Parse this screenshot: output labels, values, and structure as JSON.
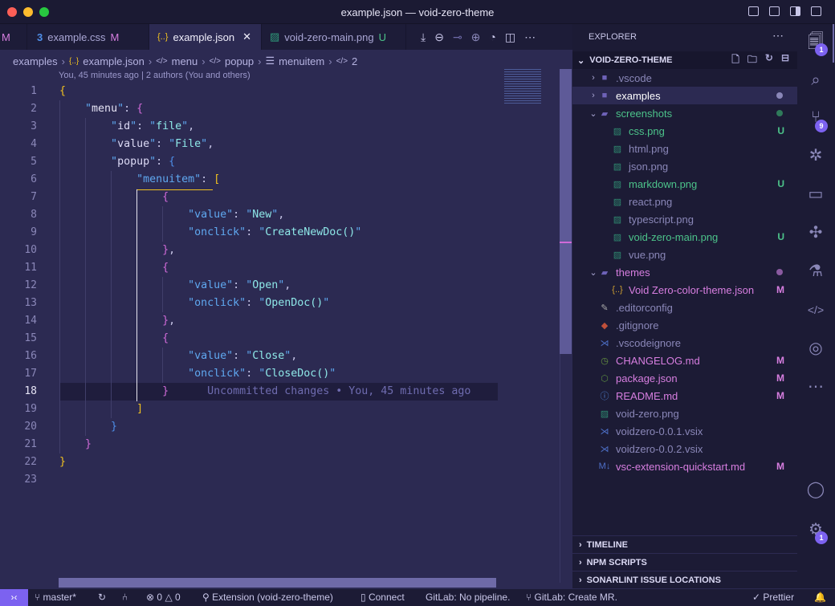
{
  "window": {
    "title": "example.json — void-zero-theme"
  },
  "colors": {
    "accent": "#7c62f0",
    "modified": "#d77ee0",
    "untracked": "#4cc38a",
    "editor_bg": "#2c2a52",
    "sidebar_bg": "#1c1b35"
  },
  "tabs": [
    {
      "label": "M",
      "icon": "css-icon"
    },
    {
      "label": "example.css",
      "status": "M",
      "icon": "css-icon"
    },
    {
      "label": "example.json",
      "icon": "json-icon",
      "active": true
    },
    {
      "label": "void-zero-main.png",
      "status": "U",
      "icon": "image-icon"
    }
  ],
  "breadcrumb": [
    "examples",
    "example.json",
    "menu",
    "popup",
    "menuitem",
    "2"
  ],
  "blame": "You, 45 minutes ago | 2 authors (You and others)",
  "code": [
    [
      [
        "{",
        "b1"
      ]
    ],
    [
      [
        "    ",
        ""
      ],
      [
        "\"",
        "q"
      ],
      [
        "menu",
        "k1"
      ],
      [
        "\"",
        "q"
      ],
      [
        ": ",
        "p"
      ],
      [
        "{",
        "b2"
      ]
    ],
    [
      [
        "        ",
        ""
      ],
      [
        "\"",
        "q"
      ],
      [
        "id",
        "k2"
      ],
      [
        "\"",
        "q"
      ],
      [
        ": ",
        "p"
      ],
      [
        "\"",
        "q"
      ],
      [
        "file",
        "s"
      ],
      [
        "\"",
        "q"
      ],
      [
        ",",
        "p"
      ]
    ],
    [
      [
        "        ",
        ""
      ],
      [
        "\"",
        "q"
      ],
      [
        "value",
        "k2"
      ],
      [
        "\"",
        "q"
      ],
      [
        ": ",
        "p"
      ],
      [
        "\"",
        "q"
      ],
      [
        "File",
        "s"
      ],
      [
        "\"",
        "q"
      ],
      [
        ",",
        "p"
      ]
    ],
    [
      [
        "        ",
        ""
      ],
      [
        "\"",
        "q"
      ],
      [
        "popup",
        "k2"
      ],
      [
        "\"",
        "q"
      ],
      [
        ": ",
        "p"
      ],
      [
        "{",
        "b3"
      ]
    ],
    [
      [
        "            ",
        ""
      ],
      [
        "\"",
        "q"
      ],
      [
        "menuitem",
        "k3"
      ],
      [
        "\"",
        "q"
      ],
      [
        ": ",
        "p"
      ],
      [
        "[",
        "b1"
      ]
    ],
    [
      [
        "                ",
        ""
      ],
      [
        "{",
        "b2"
      ]
    ],
    [
      [
        "                    ",
        ""
      ],
      [
        "\"",
        "q"
      ],
      [
        "value",
        "k3"
      ],
      [
        "\"",
        "q"
      ],
      [
        ": ",
        "p"
      ],
      [
        "\"",
        "q"
      ],
      [
        "New",
        "s"
      ],
      [
        "\"",
        "q"
      ],
      [
        ",",
        "p"
      ]
    ],
    [
      [
        "                    ",
        ""
      ],
      [
        "\"",
        "q"
      ],
      [
        "onclick",
        "k3"
      ],
      [
        "\"",
        "q"
      ],
      [
        ": ",
        "p"
      ],
      [
        "\"",
        "q"
      ],
      [
        "CreateNewDoc()",
        "s"
      ],
      [
        "\"",
        "q"
      ]
    ],
    [
      [
        "                ",
        ""
      ],
      [
        "}",
        "b2"
      ],
      [
        ",",
        "p"
      ]
    ],
    [
      [
        "                ",
        ""
      ],
      [
        "{",
        "b2"
      ]
    ],
    [
      [
        "                    ",
        ""
      ],
      [
        "\"",
        "q"
      ],
      [
        "value",
        "k3"
      ],
      [
        "\"",
        "q"
      ],
      [
        ": ",
        "p"
      ],
      [
        "\"",
        "q"
      ],
      [
        "Open",
        "s"
      ],
      [
        "\"",
        "q"
      ],
      [
        ",",
        "p"
      ]
    ],
    [
      [
        "                    ",
        ""
      ],
      [
        "\"",
        "q"
      ],
      [
        "onclick",
        "k3"
      ],
      [
        "\"",
        "q"
      ],
      [
        ": ",
        "p"
      ],
      [
        "\"",
        "q"
      ],
      [
        "OpenDoc()",
        "s"
      ],
      [
        "\"",
        "q"
      ]
    ],
    [
      [
        "                ",
        ""
      ],
      [
        "}",
        "b2"
      ],
      [
        ",",
        "p"
      ]
    ],
    [
      [
        "                ",
        ""
      ],
      [
        "{",
        "b2"
      ]
    ],
    [
      [
        "                    ",
        ""
      ],
      [
        "\"",
        "q"
      ],
      [
        "value",
        "k3"
      ],
      [
        "\"",
        "q"
      ],
      [
        ": ",
        "p"
      ],
      [
        "\"",
        "q"
      ],
      [
        "Close",
        "s"
      ],
      [
        "\"",
        "q"
      ],
      [
        ",",
        "p"
      ]
    ],
    [
      [
        "                    ",
        ""
      ],
      [
        "\"",
        "q"
      ],
      [
        "onclick",
        "k3"
      ],
      [
        "\"",
        "q"
      ],
      [
        ": ",
        "p"
      ],
      [
        "\"",
        "q"
      ],
      [
        "CloseDoc()",
        "s"
      ],
      [
        "\"",
        "q"
      ]
    ],
    [
      [
        "                ",
        ""
      ],
      [
        "}",
        "b2"
      ],
      [
        "      Uncommitted changes • You, 45 minutes ago",
        "ghost"
      ]
    ],
    [
      [
        "            ",
        ""
      ],
      [
        "]",
        "b1"
      ]
    ],
    [
      [
        "        ",
        ""
      ],
      [
        "}",
        "b3"
      ]
    ],
    [
      [
        "    ",
        ""
      ],
      [
        "}",
        "b2"
      ]
    ],
    [
      [
        "}",
        "b1"
      ]
    ],
    []
  ],
  "current_line": 18,
  "explorer": {
    "title": "EXPLORER",
    "root": "VOID-ZERO-THEME",
    "items": [
      {
        "label": ".vscode",
        "depth": 0,
        "type": "folder",
        "chev": "›",
        "color": "#8a87b8",
        "icon": "folder-icon"
      },
      {
        "label": "examples",
        "depth": 0,
        "type": "folder",
        "chev": "›",
        "color": "#ffffff",
        "dot": "#8a87b8",
        "selected": true,
        "icon": "folder-icon"
      },
      {
        "label": "screenshots",
        "depth": 0,
        "type": "folder",
        "chev": "⌄",
        "color": "#4cc38a",
        "dot": "#2f7a5a",
        "icon": "folder-open-icon"
      },
      {
        "label": "css.png",
        "depth": 1,
        "color": "#4cc38a",
        "badge": "U",
        "icon": "image-icon"
      },
      {
        "label": "html.png",
        "depth": 1,
        "color": "#8a87b8",
        "icon": "image-icon"
      },
      {
        "label": "json.png",
        "depth": 1,
        "color": "#8a87b8",
        "icon": "image-icon"
      },
      {
        "label": "markdown.png",
        "depth": 1,
        "color": "#4cc38a",
        "badge": "U",
        "icon": "image-icon"
      },
      {
        "label": "react.png",
        "depth": 1,
        "color": "#8a87b8",
        "icon": "image-icon"
      },
      {
        "label": "typescript.png",
        "depth": 1,
        "color": "#8a87b8",
        "icon": "image-icon"
      },
      {
        "label": "void-zero-main.png",
        "depth": 1,
        "color": "#4cc38a",
        "badge": "U",
        "icon": "image-icon"
      },
      {
        "label": "vue.png",
        "depth": 1,
        "color": "#8a87b8",
        "icon": "image-icon"
      },
      {
        "label": "themes",
        "depth": 0,
        "type": "folder",
        "chev": "⌄",
        "color": "#d77ee0",
        "dot": "#8a5aa0",
        "icon": "folder-open-icon"
      },
      {
        "label": "Void Zero-color-theme.json",
        "depth": 1,
        "color": "#d77ee0",
        "badge": "M",
        "icon": "json-icon"
      },
      {
        "label": ".editorconfig",
        "depth": 0,
        "color": "#8a87b8",
        "icon": "editorconfig-icon"
      },
      {
        "label": ".gitignore",
        "depth": 0,
        "color": "#8a87b8",
        "icon": "git-icon"
      },
      {
        "label": ".vscodeignore",
        "depth": 0,
        "color": "#8a87b8",
        "icon": "vscode-icon"
      },
      {
        "label": "CHANGELOG.md",
        "depth": 0,
        "color": "#d77ee0",
        "badge": "M",
        "icon": "history-icon"
      },
      {
        "label": "package.json",
        "depth": 0,
        "color": "#d77ee0",
        "badge": "M",
        "icon": "nodejs-icon"
      },
      {
        "label": "README.md",
        "depth": 0,
        "color": "#d77ee0",
        "badge": "M",
        "icon": "info-icon"
      },
      {
        "label": "void-zero.png",
        "depth": 0,
        "color": "#8a87b8",
        "icon": "image-icon"
      },
      {
        "label": "voidzero-0.0.1.vsix",
        "depth": 0,
        "color": "#8a87b8",
        "icon": "vscode-icon"
      },
      {
        "label": "voidzero-0.0.2.vsix",
        "depth": 0,
        "color": "#8a87b8",
        "icon": "vscode-icon"
      },
      {
        "label": "vsc-extension-quickstart.md",
        "depth": 0,
        "color": "#d77ee0",
        "badge": "M",
        "icon": "markdown-icon"
      }
    ],
    "sections": [
      "TIMELINE",
      "NPM SCRIPTS",
      "SONARLINT ISSUE LOCATIONS"
    ]
  },
  "activity": {
    "explorer_badge": "1",
    "scm_badge": "9",
    "settings_badge": "1"
  },
  "status": {
    "branch": "master*",
    "errors": "0",
    "warnings": "0",
    "extension": "Extension (void-zero-theme)",
    "connect": "Connect",
    "gitlab_pipeline": "GitLab: No pipeline.",
    "gitlab_mr": "GitLab: Create MR.",
    "prettier": "Prettier"
  }
}
